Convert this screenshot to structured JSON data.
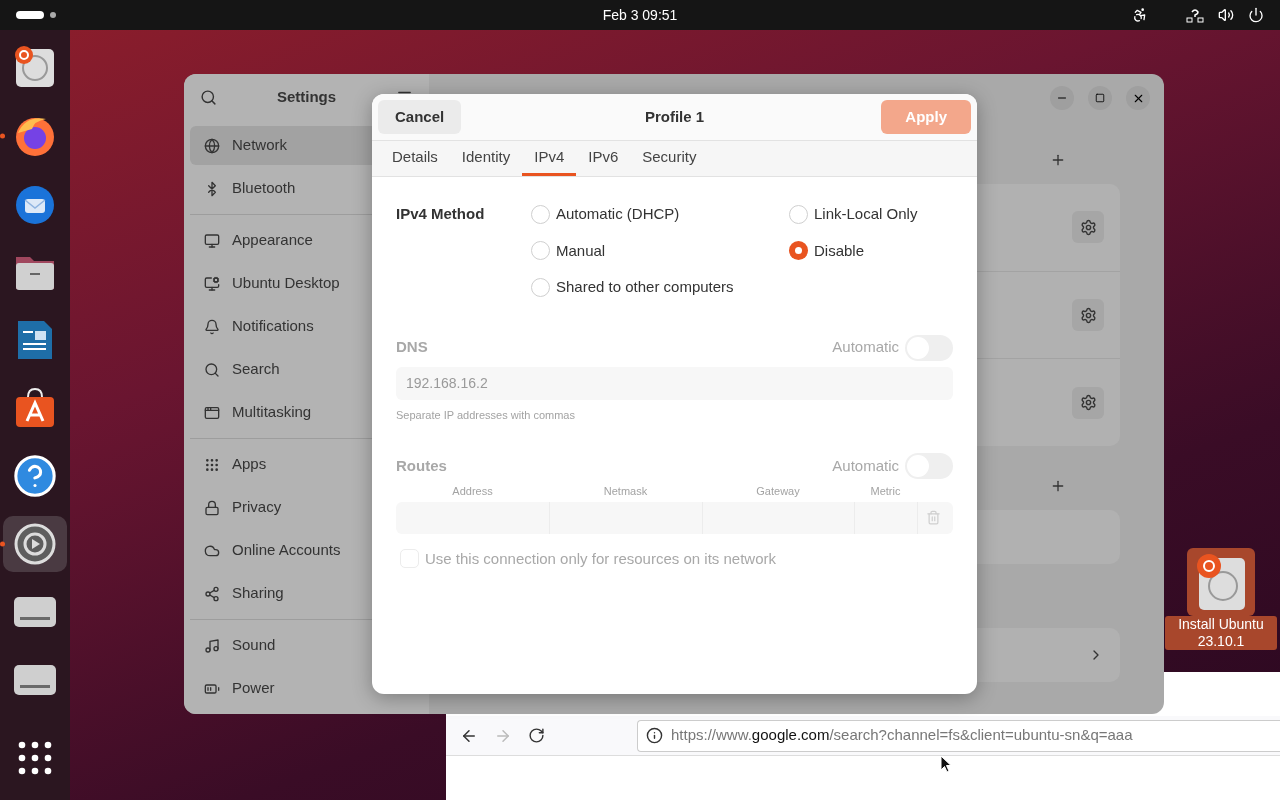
{
  "top_bar": {
    "clock": "Feb 3  09:51"
  },
  "dock": [
    {
      "kind": "installer",
      "running": false,
      "selected": false
    },
    {
      "kind": "firefox",
      "running": true,
      "selected": false
    },
    {
      "kind": "thunderbird",
      "running": false,
      "selected": false
    },
    {
      "kind": "files",
      "running": false,
      "selected": false
    },
    {
      "kind": "writer",
      "running": false,
      "selected": false
    },
    {
      "kind": "store",
      "running": false,
      "selected": false
    },
    {
      "kind": "help",
      "running": false,
      "selected": false
    },
    {
      "kind": "settings",
      "running": true,
      "selected": true
    },
    {
      "kind": "drive",
      "running": false,
      "selected": false
    },
    {
      "kind": "drive",
      "running": false,
      "selected": false
    },
    {
      "kind": "apps",
      "running": false,
      "selected": false
    }
  ],
  "settings": {
    "title": "Settings",
    "sidebar": [
      [
        {
          "kind": "network",
          "label": "Network",
          "selected": true
        },
        {
          "kind": "bluetooth",
          "label": "Bluetooth",
          "selected": false
        }
      ],
      [
        {
          "kind": "appearance",
          "label": "Appearance",
          "selected": false
        },
        {
          "kind": "desktop",
          "label": "Ubuntu Desktop",
          "selected": false
        },
        {
          "kind": "notifications",
          "label": "Notifications",
          "selected": false
        },
        {
          "kind": "search",
          "label": "Search",
          "selected": false
        },
        {
          "kind": "multitasking",
          "label": "Multitasking",
          "selected": false
        }
      ],
      [
        {
          "kind": "apps",
          "label": "Apps",
          "selected": false
        },
        {
          "kind": "privacy",
          "label": "Privacy",
          "selected": false
        },
        {
          "kind": "accounts",
          "label": "Online Accounts",
          "selected": false
        },
        {
          "kind": "sharing",
          "label": "Sharing",
          "selected": false
        }
      ],
      [
        {
          "kind": "sound",
          "label": "Sound",
          "selected": false
        },
        {
          "kind": "power",
          "label": "Power",
          "selected": false
        }
      ]
    ]
  },
  "dialog": {
    "cancel": "Cancel",
    "title": "Profile 1",
    "apply": {
      "label": "Apply",
      "disabled": true
    },
    "tabs": [
      {
        "label": "Details",
        "selected": false
      },
      {
        "label": "Identity",
        "selected": false
      },
      {
        "label": "IPv4",
        "selected": true
      },
      {
        "label": "IPv6",
        "selected": false
      },
      {
        "label": "Security",
        "selected": false
      }
    ],
    "method_label": "IPv4 Method",
    "methods": [
      {
        "label": "Automatic (DHCP)",
        "selected": false
      },
      {
        "label": "Link-Local Only",
        "selected": false
      },
      {
        "label": "Manual",
        "selected": false
      },
      {
        "label": "Disable",
        "selected": true
      },
      {
        "label": "Shared to other computers",
        "selected": false
      }
    ],
    "dns": {
      "label": "DNS",
      "disabled": true,
      "automatic_label": "Automatic",
      "on": false,
      "value": "192.168.16.2",
      "hint": "Separate IP addresses with commas"
    },
    "routes": {
      "label": "Routes",
      "disabled": true,
      "automatic_label": "Automatic",
      "on": false,
      "columns": [
        "Address",
        "Netmask",
        "Gateway",
        "Metric"
      ]
    },
    "only_local": {
      "label": "Use this connection only for resources on its network",
      "checked": false,
      "disabled": true
    }
  },
  "browser": {
    "forward_disabled": true,
    "url": "https://www.**google.com**/search?channel=fs&client=ubuntu-sn&q=aaa"
  },
  "desktop_icon": {
    "label": "Install Ubuntu 23.10.1"
  }
}
